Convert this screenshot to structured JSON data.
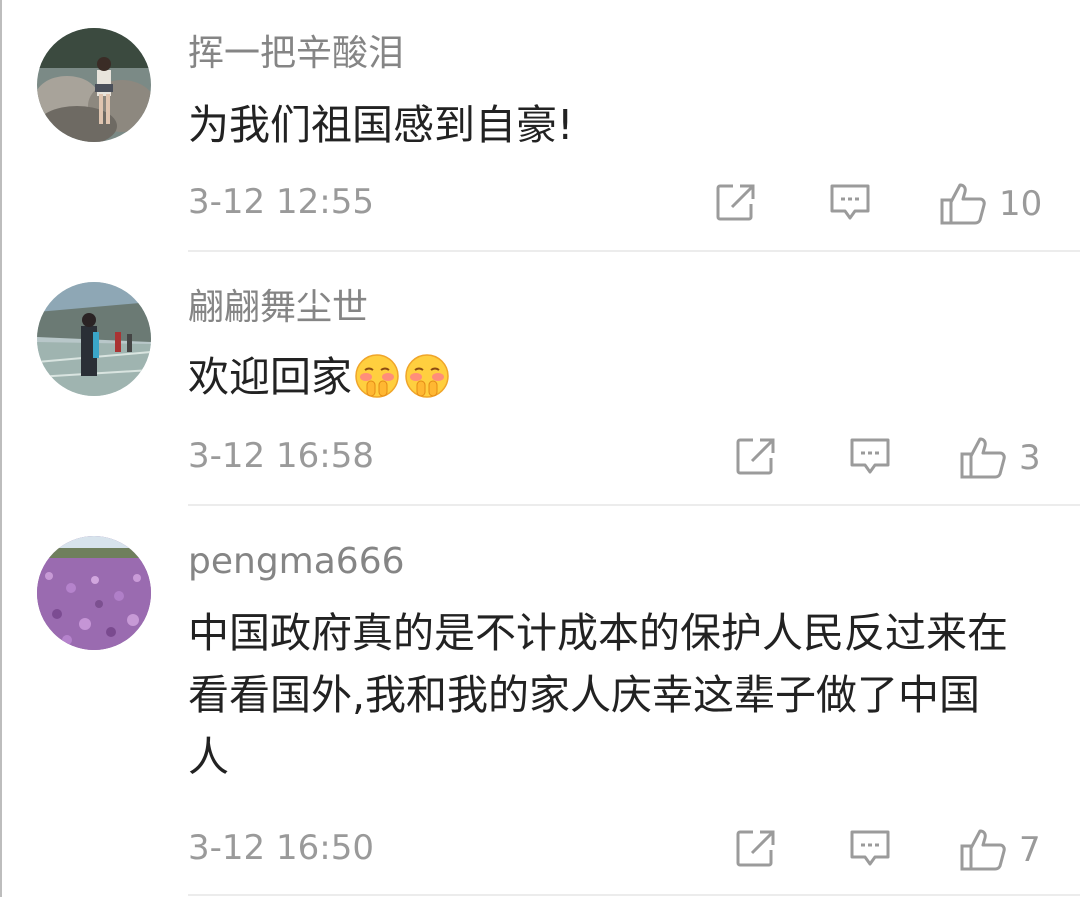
{
  "comments": [
    {
      "username": "挥一把辛酸泪",
      "text": "为我们祖国感到自豪!",
      "time": "3-12 12:55",
      "likes": "10",
      "emojis": []
    },
    {
      "username": "翩翩舞尘世",
      "text": "欢迎回家",
      "time": "3-12 16:58",
      "likes": "3",
      "emojis": [
        "shy-face-emoji",
        "shy-face-emoji"
      ]
    },
    {
      "username": "pengma666",
      "text": "中国政府真的是不计成本的保护人民反过来在看看国外,我和我的家人庆幸这辈子做了中国人",
      "time": "3-12 16:50",
      "likes": "7",
      "emojis": []
    }
  ],
  "icons": {
    "share": "share-icon",
    "reply": "comment-icon",
    "like": "thumbs-up-icon"
  },
  "colors": {
    "username": "#858585",
    "text": "#222222",
    "meta": "#9a9a9a",
    "icon": "#9b9b9b",
    "divider": "#ececec"
  }
}
